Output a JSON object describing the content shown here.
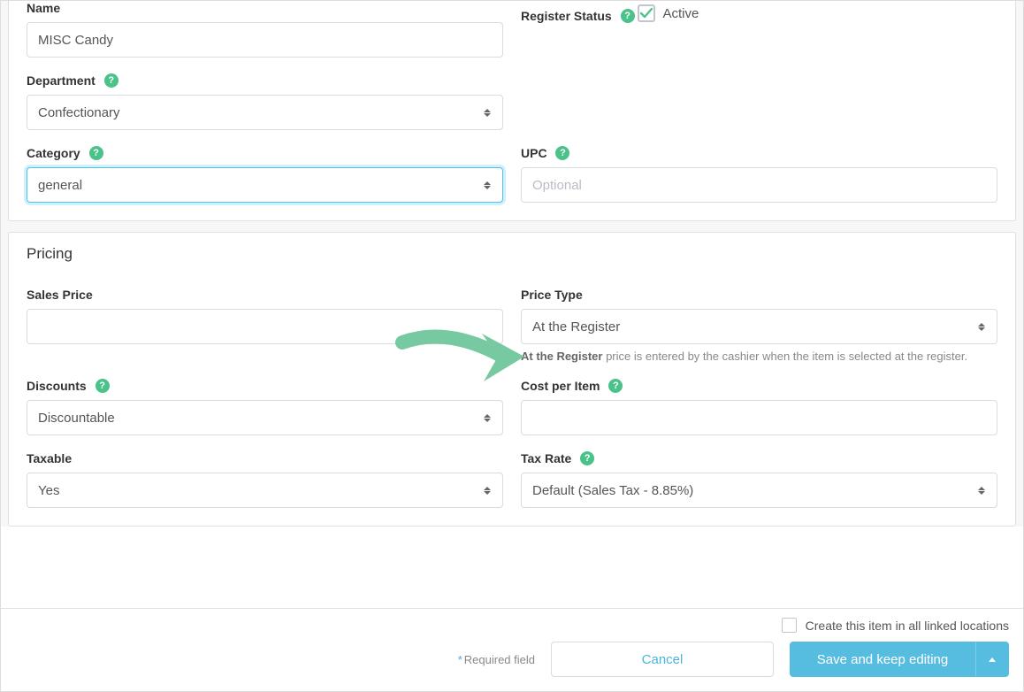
{
  "name": {
    "label": "Name",
    "value": "MISC Candy"
  },
  "register_status": {
    "label": "Register Status",
    "checkbox_label": "Active",
    "checked": true
  },
  "department": {
    "label": "Department",
    "value": "Confectionary"
  },
  "category": {
    "label": "Category",
    "value": "general"
  },
  "upc": {
    "label": "UPC",
    "placeholder": "Optional",
    "value": ""
  },
  "pricing": {
    "section_title": "Pricing",
    "sales_price": {
      "label": "Sales Price",
      "value": ""
    },
    "price_type": {
      "label": "Price Type",
      "value": "At the Register",
      "helper_strong": "At the Register",
      "helper_rest": " price is entered by the cashier when the item is selected at the register."
    },
    "discounts": {
      "label": "Discounts",
      "value": "Discountable"
    },
    "cost_per_item": {
      "label": "Cost per Item",
      "value": ""
    },
    "taxable": {
      "label": "Taxable",
      "value": "Yes"
    },
    "tax_rate": {
      "label": "Tax Rate",
      "value": "Default (Sales Tax - 8.85%)"
    }
  },
  "footer": {
    "linked_locations": "Create this item in all linked locations",
    "required_hint": "Required field",
    "cancel": "Cancel",
    "save": "Save and keep editing"
  }
}
